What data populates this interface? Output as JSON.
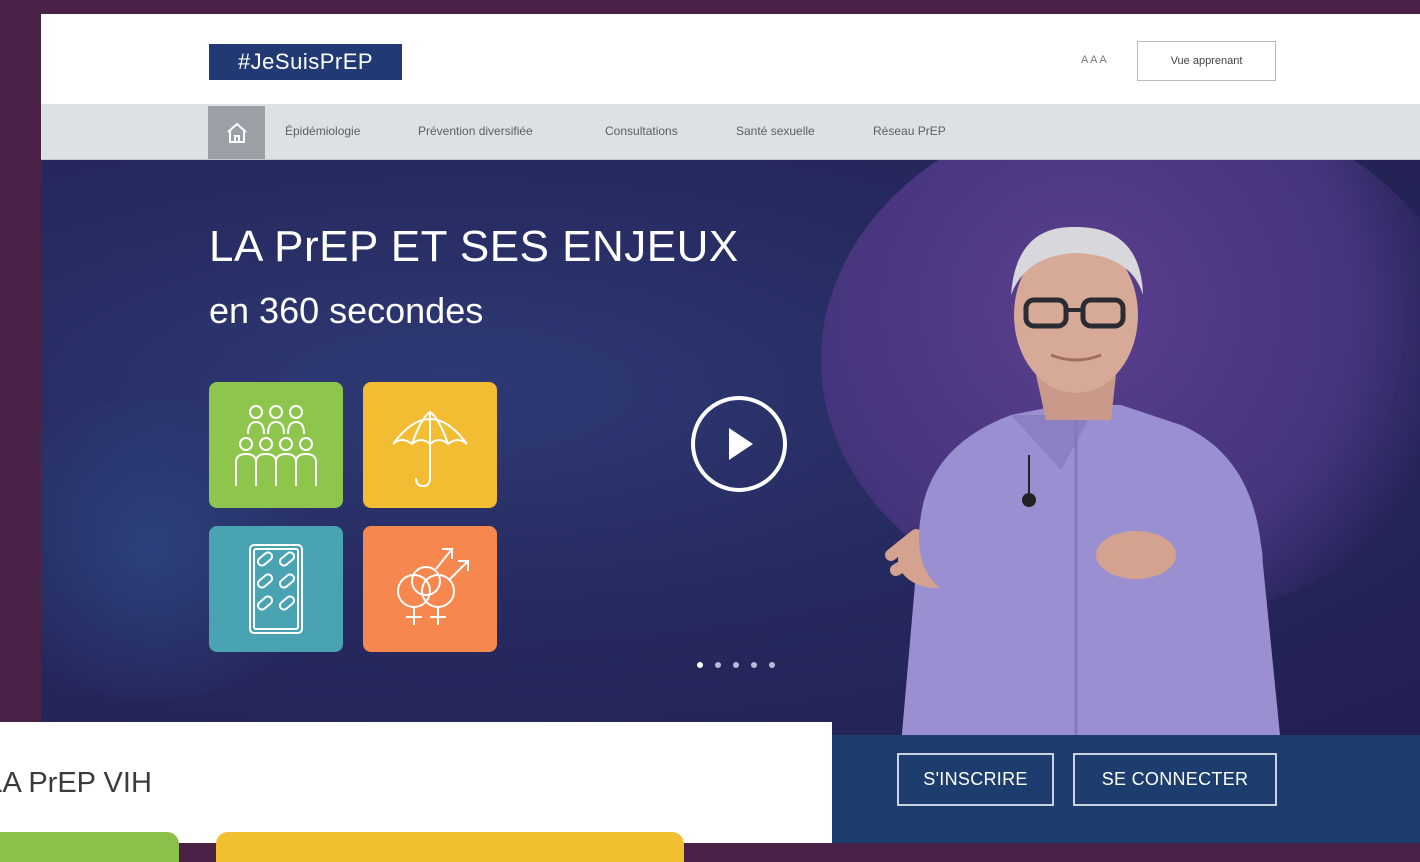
{
  "header": {
    "logo_text": "#JeSuisPrEP",
    "font_size_control": "A A A",
    "appearance_button": "Vue apprenant"
  },
  "nav": {
    "items": [
      "Épidémiologie",
      "Prévention diversifiée",
      "Consultations",
      "Santé sexuelle",
      "Réseau PrEP"
    ]
  },
  "hero": {
    "title": "LA PrEP ET SES ENJEUX",
    "subtitle": "en 360 secondes",
    "slides_total": 5,
    "slide_active": 1,
    "tile_colors": [
      "#8dc54d",
      "#f3bd33",
      "#4aa3b3",
      "#f6874f"
    ]
  },
  "auth": {
    "signup_label": "S'INSCRIRE",
    "login_label": "SE CONNECTER"
  },
  "section": {
    "heading": "À LA PrEP VIH"
  },
  "colors": {
    "accent_blue": "#1d3d6e",
    "logo_blue": "#223a73",
    "frame_purple": "#4a2147"
  }
}
